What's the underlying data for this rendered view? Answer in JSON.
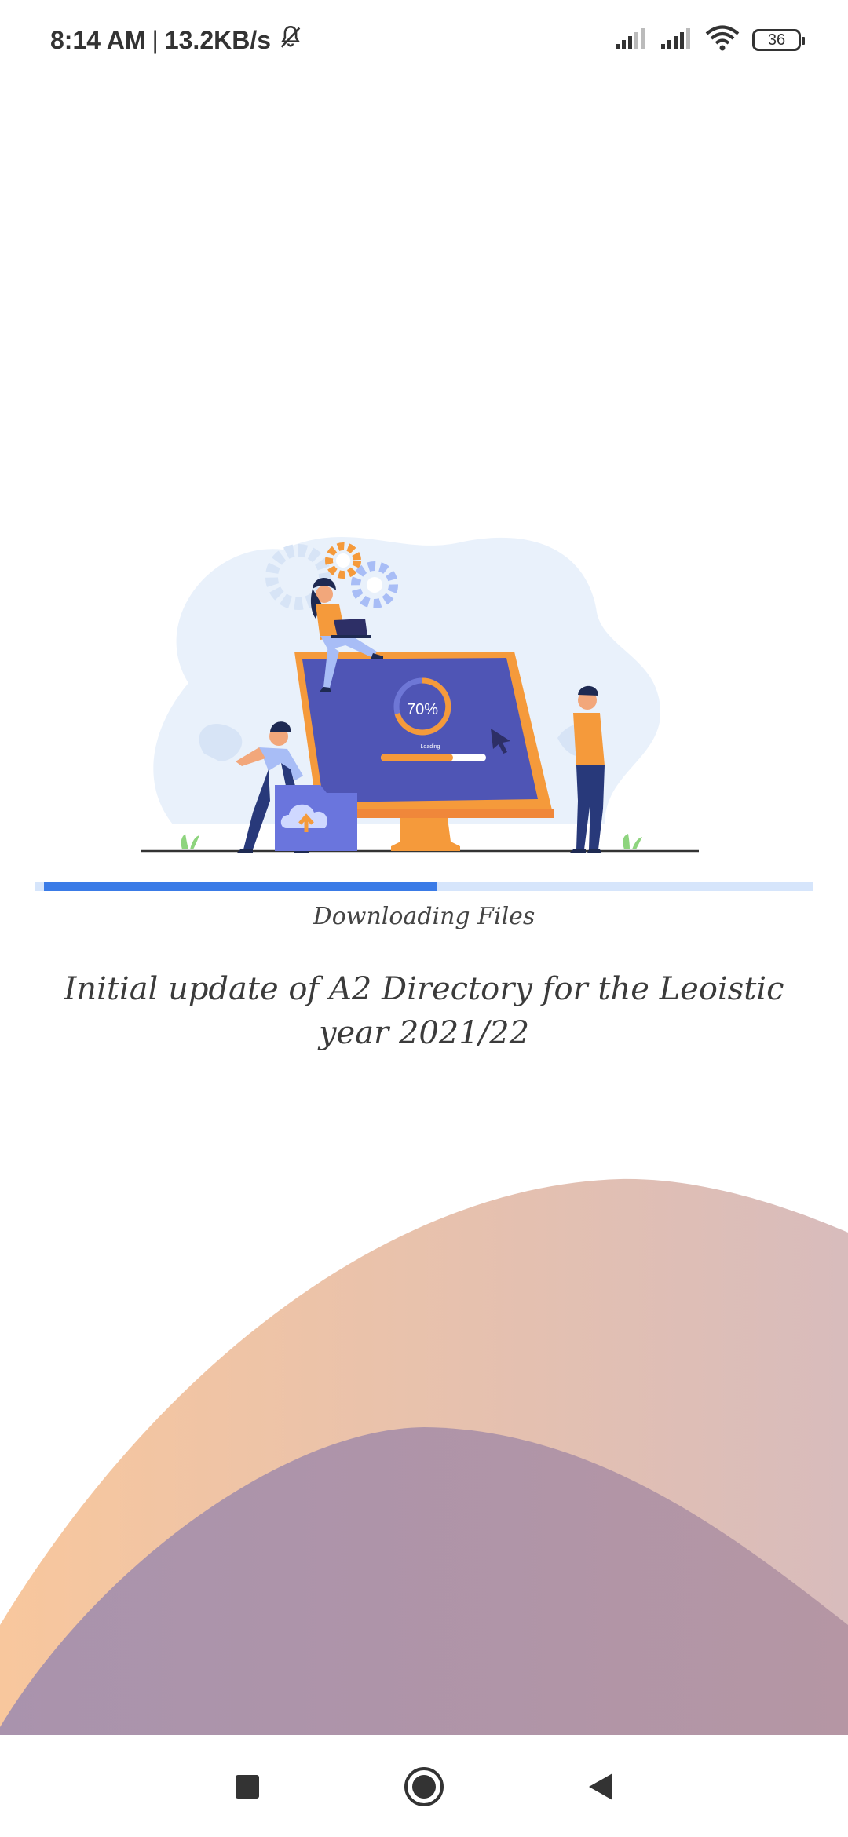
{
  "status_bar": {
    "time": "8:14 AM",
    "network_speed": "13.2KB/s",
    "separator": "|",
    "battery": "36",
    "icons": [
      "bell-off-icon",
      "signal-icon",
      "signal-icon",
      "wifi-icon",
      "battery-icon"
    ]
  },
  "illustration": {
    "progress_label": "70%",
    "loading_label": "Loading"
  },
  "download": {
    "progress": 0.505,
    "status": "Downloading Files",
    "message": "Initial update of A2 Directory for the Leoistic year 2021/22"
  },
  "colors": {
    "progress_fill": "#3a7be7",
    "progress_track": "#d6e5fb",
    "wave_back": "#f5c6a0",
    "wave_front": "#a88ca8"
  },
  "nav": {
    "icons": [
      "recent-apps-icon",
      "home-icon",
      "back-icon"
    ]
  }
}
